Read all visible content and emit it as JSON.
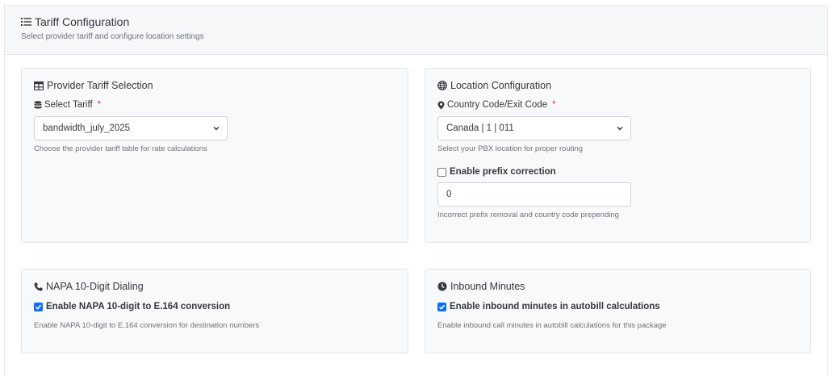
{
  "header": {
    "title": "Tariff Configuration",
    "subtitle": "Select provider tariff and configure location settings"
  },
  "tariff_panel": {
    "title": "Provider Tariff Selection",
    "label": "Select Tariff",
    "required_mark": "*",
    "selected": "bandwidth_july_2025",
    "help": "Choose the provider tariff table for rate calculations"
  },
  "location_panel": {
    "title": "Location Configuration",
    "label": "Country Code/Exit Code",
    "required_mark": "*",
    "selected": "Canada | 1 | 011",
    "help": "Select your PBX location for proper routing",
    "prefix_checkbox_label": "Enable prefix correction",
    "prefix_checked": false,
    "prefix_value": "0",
    "prefix_help": "Incorrect prefix removal and country code prepending"
  },
  "napa_panel": {
    "title": "NAPA 10-Digit Dialing",
    "checkbox_label": "Enable NAPA 10-digit to E.164 conversion",
    "checked": true,
    "help": "Enable NAPA 10-digit to E.164 conversion for destination numbers"
  },
  "inbound_panel": {
    "title": "Inbound Minutes",
    "checkbox_label": "Enable inbound minutes in autobill calculations",
    "checked": true,
    "help": "Enable inbound call minutes in autobill calculations for this package"
  },
  "colors": {
    "accent": "#0d6efd",
    "required": "#dc3545",
    "panel_bg": "#f8f9fa",
    "header_bg": "#f5f7f9"
  }
}
